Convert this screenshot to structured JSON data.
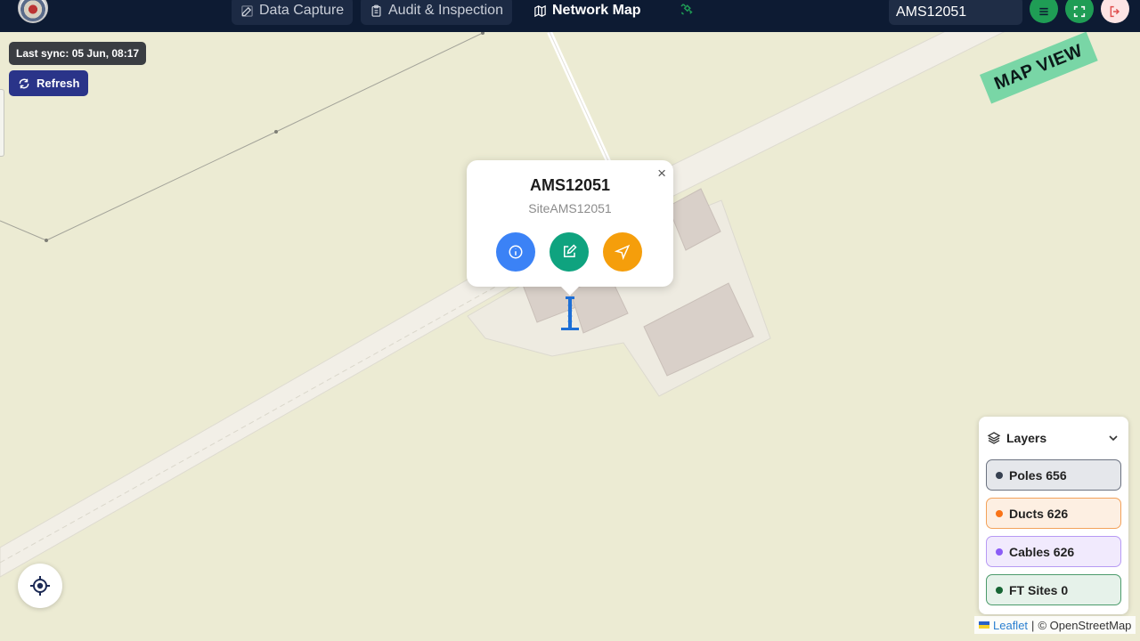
{
  "header": {
    "tabs": [
      {
        "label": "Data Capture",
        "icon": "edit-icon",
        "active": false
      },
      {
        "label": "Audit & Inspection",
        "icon": "clipboard-icon",
        "active": false
      },
      {
        "label": "Network Map",
        "icon": "map-icon",
        "active": true
      }
    ],
    "search_value": "AMS12051",
    "colors": {
      "bar": "#0d1b33",
      "green": "#1f9d55",
      "logout_bg": "#fde4e4",
      "logout_icon": "#e05050"
    }
  },
  "map": {
    "sync_label": "Last sync: 05 Jun, 08:17",
    "refresh_label": "Refresh",
    "watermark": "MAP VIEW"
  },
  "popup": {
    "title": "AMS12051",
    "subtitle": "SiteAMS12051",
    "close_symbol": "×",
    "actions": [
      {
        "icon": "info-icon",
        "color": "#3b82f6"
      },
      {
        "icon": "edit-icon",
        "color": "#0fa37f"
      },
      {
        "icon": "navigate-icon",
        "color": "#f59e0b"
      }
    ]
  },
  "layers": {
    "title": "Layers",
    "items": [
      {
        "label": "Poles 656",
        "dot": "#374151",
        "bg": "#e5e7eb",
        "border": "#6b7280"
      },
      {
        "label": "Ducts 626",
        "dot": "#f97316",
        "bg": "#fdefe2",
        "border": "#f3a25a"
      },
      {
        "label": "Cables 626",
        "dot": "#8b5cf6",
        "bg": "#f1eafd",
        "border": "#b79af4"
      },
      {
        "label": "FT Sites 0",
        "dot": "#166534",
        "bg": "#e6f2ea",
        "border": "#4b9b6b"
      }
    ]
  },
  "attribution": {
    "leaflet": "Leaflet",
    "separator": "|",
    "osm": "© OpenStreetMap"
  }
}
